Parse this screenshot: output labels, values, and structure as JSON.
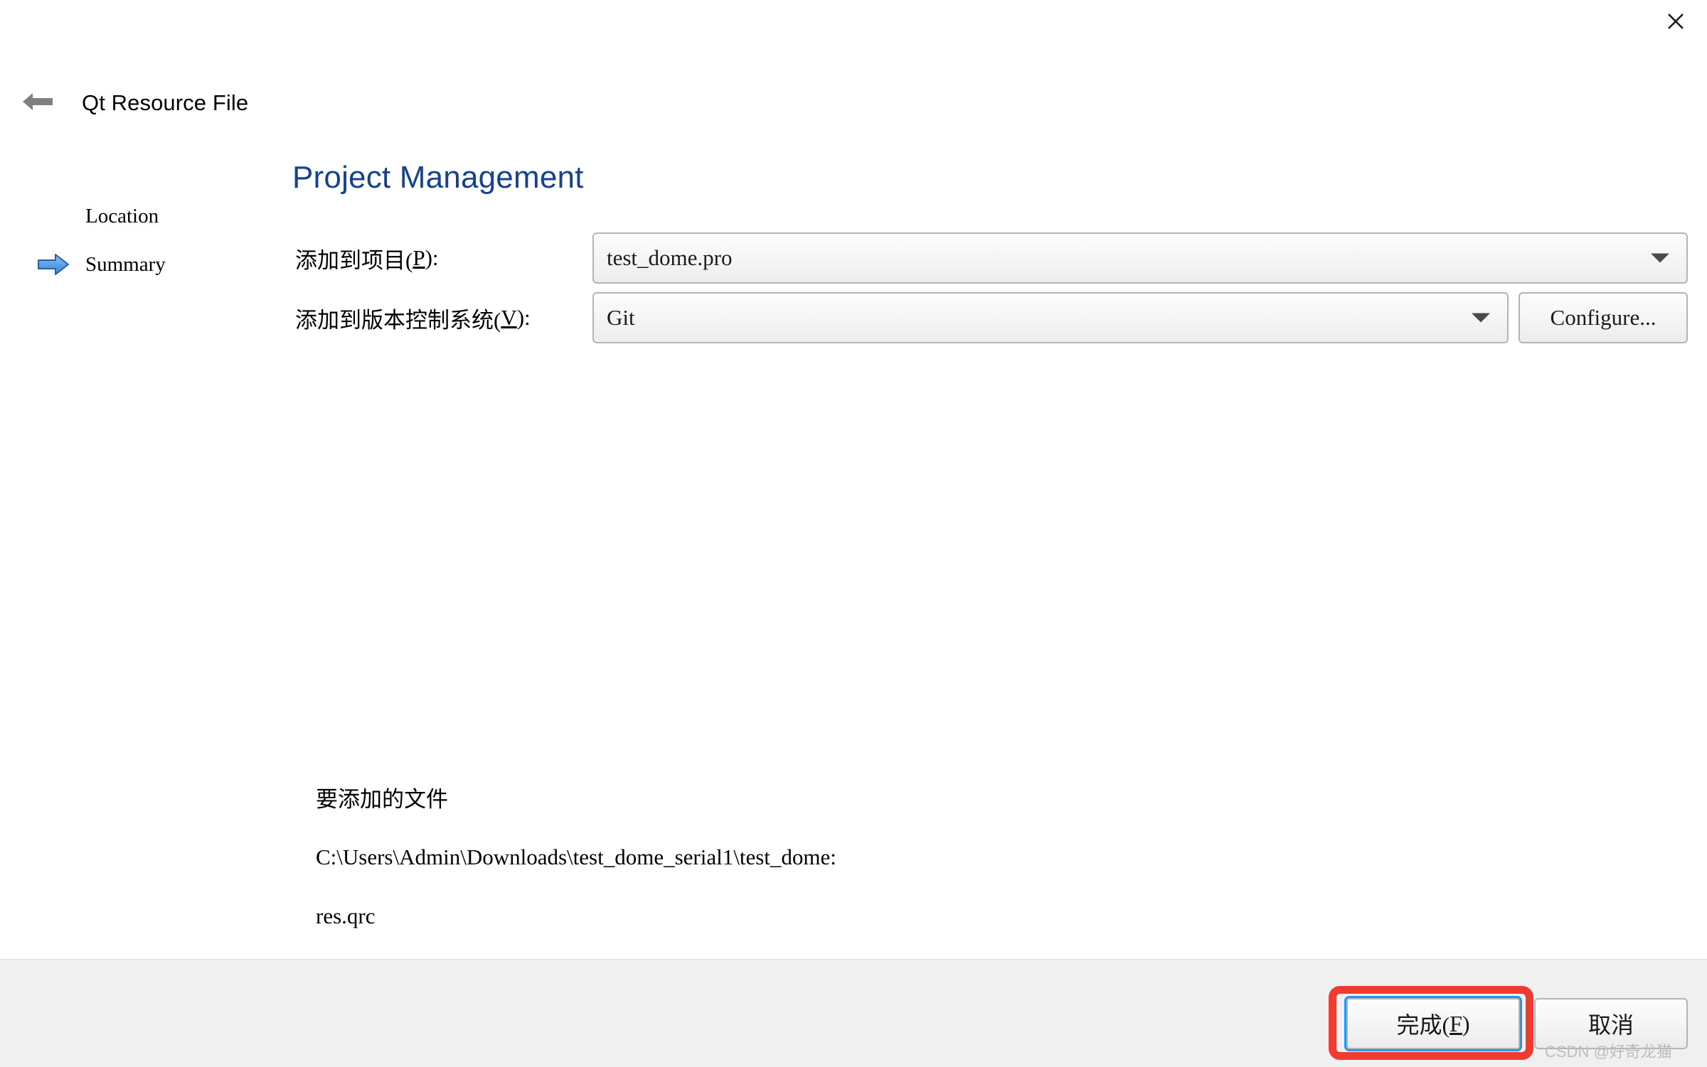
{
  "window": {
    "close_icon": "close-icon"
  },
  "header": {
    "back_icon": "arrow-left-icon",
    "title": "Qt Resource File"
  },
  "sidebar": {
    "items": [
      {
        "label": "Location",
        "active": false,
        "icon": ""
      },
      {
        "label": "Summary",
        "active": true,
        "icon": "arrow-right-blue-icon"
      }
    ]
  },
  "main": {
    "heading": "Project Management",
    "heading_color": "#17428c",
    "fields": [
      {
        "label_prefix": "添加到项目(",
        "label_mnemonic": "P",
        "label_suffix": "):",
        "value": "test_dome.pro",
        "dropdown_icon": "chevron-down-icon"
      },
      {
        "label_prefix": "添加到版本控制系统(",
        "label_mnemonic": "V",
        "label_suffix": "):",
        "value": "Git",
        "dropdown_icon": "chevron-down-icon"
      }
    ],
    "configure_button": "Configure...",
    "files_section": {
      "title": "要添加的文件",
      "path": "C:\\Users\\Admin\\Downloads\\test_dome_serial1\\test_dome:",
      "file": "res.qrc"
    }
  },
  "footer": {
    "finish_prefix": "完成(",
    "finish_mnemonic": "F",
    "finish_suffix": ")",
    "cancel_label": "取消",
    "highlight_color": "#f03b30",
    "focus_color": "#2196f3"
  },
  "watermark": "CSDN @好奇龙猫"
}
